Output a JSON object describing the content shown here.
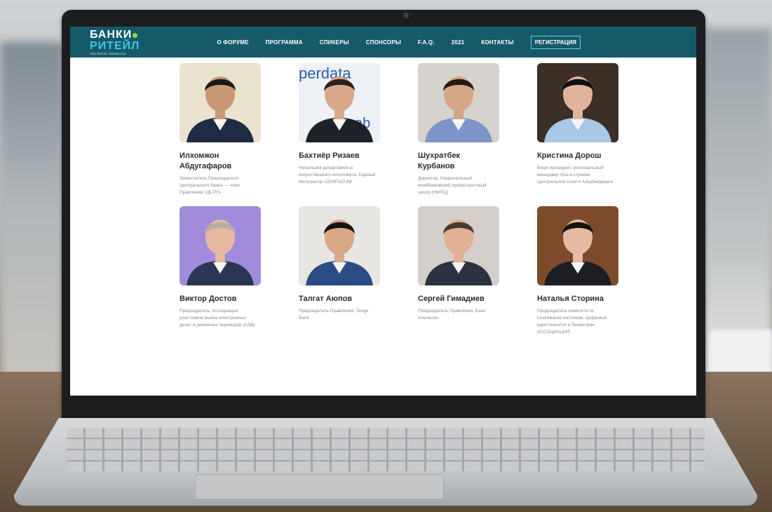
{
  "site": {
    "logo": {
      "line1": "БАНКИ",
      "line2": "РИТЕЙЛ",
      "subtitle": "XVIII ФОРУМ УЗБЕКИСТАН"
    },
    "nav": [
      {
        "label": "О ФОРУМЕ"
      },
      {
        "label": "ПРОГРАММА"
      },
      {
        "label": "СПИКЕРЫ"
      },
      {
        "label": "СПОНСОРЫ"
      },
      {
        "label": "F.A.Q."
      },
      {
        "label": "2021"
      },
      {
        "label": "КОНТАКТЫ"
      }
    ],
    "register_label": "РЕГИСТРАЦИЯ"
  },
  "speakers": [
    {
      "name": "Илхомжон Абдугафаров",
      "role": "Заместитель Председателя Центрального банка — член Правления, ЦБ РУз",
      "photo_bg": "#e9e3cf",
      "suit": "#1f2a44",
      "skin": "#c99873",
      "hair": "#1c1a18"
    },
    {
      "name": "Бахтиёр Ризаев",
      "role": "Начальник департамента искусственного интеллекта, Единый Интегратор UZINFOCOM",
      "photo_bg": "#eef1f5",
      "suit": "#1e2128",
      "skin": "#d9a88a",
      "hair": "#2b211c",
      "backdrop_text": "perdata",
      "backdrop_text2": "cab"
    },
    {
      "name": "Шухратбек Курбанов",
      "role": "Директор, Национальный межбанковский процессинговый центр (НМПЦ)",
      "photo_bg": "#d6d2cd",
      "suit": "#7d95c8",
      "skin": "#d5a787",
      "hair": "#231a15"
    },
    {
      "name": "Кристина Дорош",
      "role": "Вице-президент, региональный менеджер Visa в странах Центральной Азии и Азербайджане",
      "photo_bg": "#3b2f28",
      "suit": "#a9c7e6",
      "skin": "#e2b39c",
      "hair": "#120f0e"
    },
    {
      "name": "Виктор Достов",
      "role": "Председатель, Ассоциация участников рынка электронных денег и денежных переводов (АЭД)",
      "photo_bg": "#a18cdc",
      "suit": "#2b3554",
      "skin": "#e8b8a0",
      "hair": "#b9aea6"
    },
    {
      "name": "Талгат Аюпов",
      "role": "Председатель Правления, Tenge Bank",
      "photo_bg": "#e7e6e2",
      "suit": "#2a4b83",
      "skin": "#d8a887",
      "hair": "#171412"
    },
    {
      "name": "Сергей Гимадиев",
      "role": "Председатель Правления, Банк Апельсин",
      "photo_bg": "#d4cfcb",
      "suit": "#2d3241",
      "skin": "#e2b193",
      "hair": "#4b3a2f"
    },
    {
      "name": "Наталья Сторина",
      "role": "Председатель комитета по платежным системам, цифровой идентичности и биометрии, АССОЦИАЦИЯ",
      "photo_bg": "#7d4b2c",
      "suit": "#1d1e24",
      "skin": "#e7bba3",
      "hair": "#17110e"
    }
  ]
}
